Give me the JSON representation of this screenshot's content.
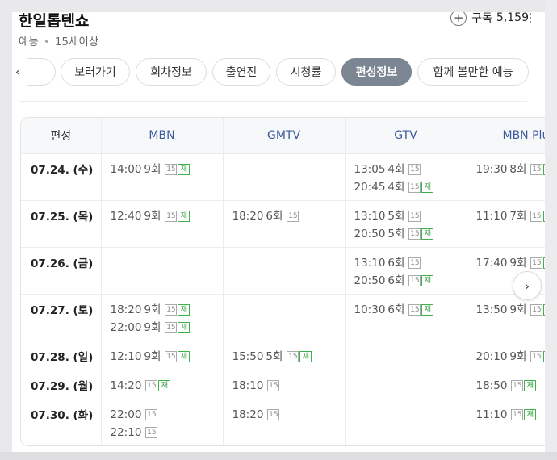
{
  "header": {
    "title": "한일톱텐쇼",
    "genre": "예능",
    "age": "15세이상",
    "subscribe_label": "구독",
    "subscriber_count": "5,159"
  },
  "tabs": [
    {
      "label": "",
      "active": false
    },
    {
      "label": "보러가기",
      "active": false
    },
    {
      "label": "회차정보",
      "active": false
    },
    {
      "label": "출연진",
      "active": false
    },
    {
      "label": "시청률",
      "active": false
    },
    {
      "label": "편성정보",
      "active": true
    },
    {
      "label": "함께 볼만한 예능",
      "active": false
    }
  ],
  "schedule": {
    "corner_label": "편성",
    "channels": [
      "MBN",
      "GMTV",
      "GTV",
      "MBN Plus"
    ],
    "rows": [
      {
        "date": "07.24. (수)",
        "cells": [
          [
            {
              "time": "14:00",
              "ep": "9회",
              "rating": "15",
              "rerun": "재"
            }
          ],
          [],
          [
            {
              "time": "13:05",
              "ep": "4회",
              "rating": "15",
              "rerun": ""
            },
            {
              "time": "20:45",
              "ep": "4회",
              "rating": "15",
              "rerun": "재"
            }
          ],
          [
            {
              "time": "19:30",
              "ep": "8회",
              "rating": "15",
              "rerun": "재"
            }
          ]
        ]
      },
      {
        "date": "07.25. (목)",
        "cells": [
          [
            {
              "time": "12:40",
              "ep": "9회",
              "rating": "15",
              "rerun": "재"
            }
          ],
          [
            {
              "time": "18:20",
              "ep": "6회",
              "rating": "15",
              "rerun": ""
            }
          ],
          [
            {
              "time": "13:10",
              "ep": "5회",
              "rating": "15",
              "rerun": ""
            },
            {
              "time": "20:50",
              "ep": "5회",
              "rating": "15",
              "rerun": "재"
            }
          ],
          [
            {
              "time": "11:10",
              "ep": "7회",
              "rating": "15",
              "rerun": "재"
            }
          ]
        ]
      },
      {
        "date": "07.26. (금)",
        "cells": [
          [],
          [],
          [
            {
              "time": "13:10",
              "ep": "6회",
              "rating": "15",
              "rerun": ""
            },
            {
              "time": "20:50",
              "ep": "6회",
              "rating": "15",
              "rerun": "재"
            }
          ],
          [
            {
              "time": "17:40",
              "ep": "9회",
              "rating": "15",
              "rerun": "재"
            }
          ]
        ]
      },
      {
        "date": "07.27. (토)",
        "cells": [
          [
            {
              "time": "18:20",
              "ep": "9회",
              "rating": "15",
              "rerun": "재"
            },
            {
              "time": "22:00",
              "ep": "9회",
              "rating": "15",
              "rerun": "재"
            }
          ],
          [],
          [
            {
              "time": "10:30",
              "ep": "6회",
              "rating": "15",
              "rerun": "재"
            }
          ],
          [
            {
              "time": "13:50",
              "ep": "9회",
              "rating": "15",
              "rerun": "재"
            }
          ]
        ]
      },
      {
        "date": "07.28. (일)",
        "cells": [
          [
            {
              "time": "12:10",
              "ep": "9회",
              "rating": "15",
              "rerun": "재"
            }
          ],
          [
            {
              "time": "15:50",
              "ep": "5회",
              "rating": "15",
              "rerun": "재"
            }
          ],
          [],
          [
            {
              "time": "20:10",
              "ep": "9회",
              "rating": "15",
              "rerun": "재"
            }
          ]
        ]
      },
      {
        "date": "07.29. (월)",
        "cells": [
          [
            {
              "time": "14:20",
              "ep": "",
              "rating": "15",
              "rerun": "재"
            }
          ],
          [
            {
              "time": "18:10",
              "ep": "",
              "rating": "15",
              "rerun": ""
            }
          ],
          [],
          [
            {
              "time": "18:50",
              "ep": "",
              "rating": "15",
              "rerun": "재"
            }
          ]
        ]
      },
      {
        "date": "07.30. (화)",
        "cells": [
          [
            {
              "time": "22:00",
              "ep": "",
              "rating": "15",
              "rerun": ""
            },
            {
              "time": "22:10",
              "ep": "",
              "rating": "15",
              "rerun": ""
            }
          ],
          [
            {
              "time": "18:20",
              "ep": "",
              "rating": "15",
              "rerun": ""
            }
          ],
          [],
          [
            {
              "time": "11:10",
              "ep": "",
              "rating": "15",
              "rerun": "재"
            }
          ]
        ]
      }
    ]
  },
  "icons": {
    "prev": "chevron-left-icon",
    "next": "chevron-right-icon",
    "subscribe": "plus-circle-icon",
    "more": "more-vertical-icon"
  }
}
